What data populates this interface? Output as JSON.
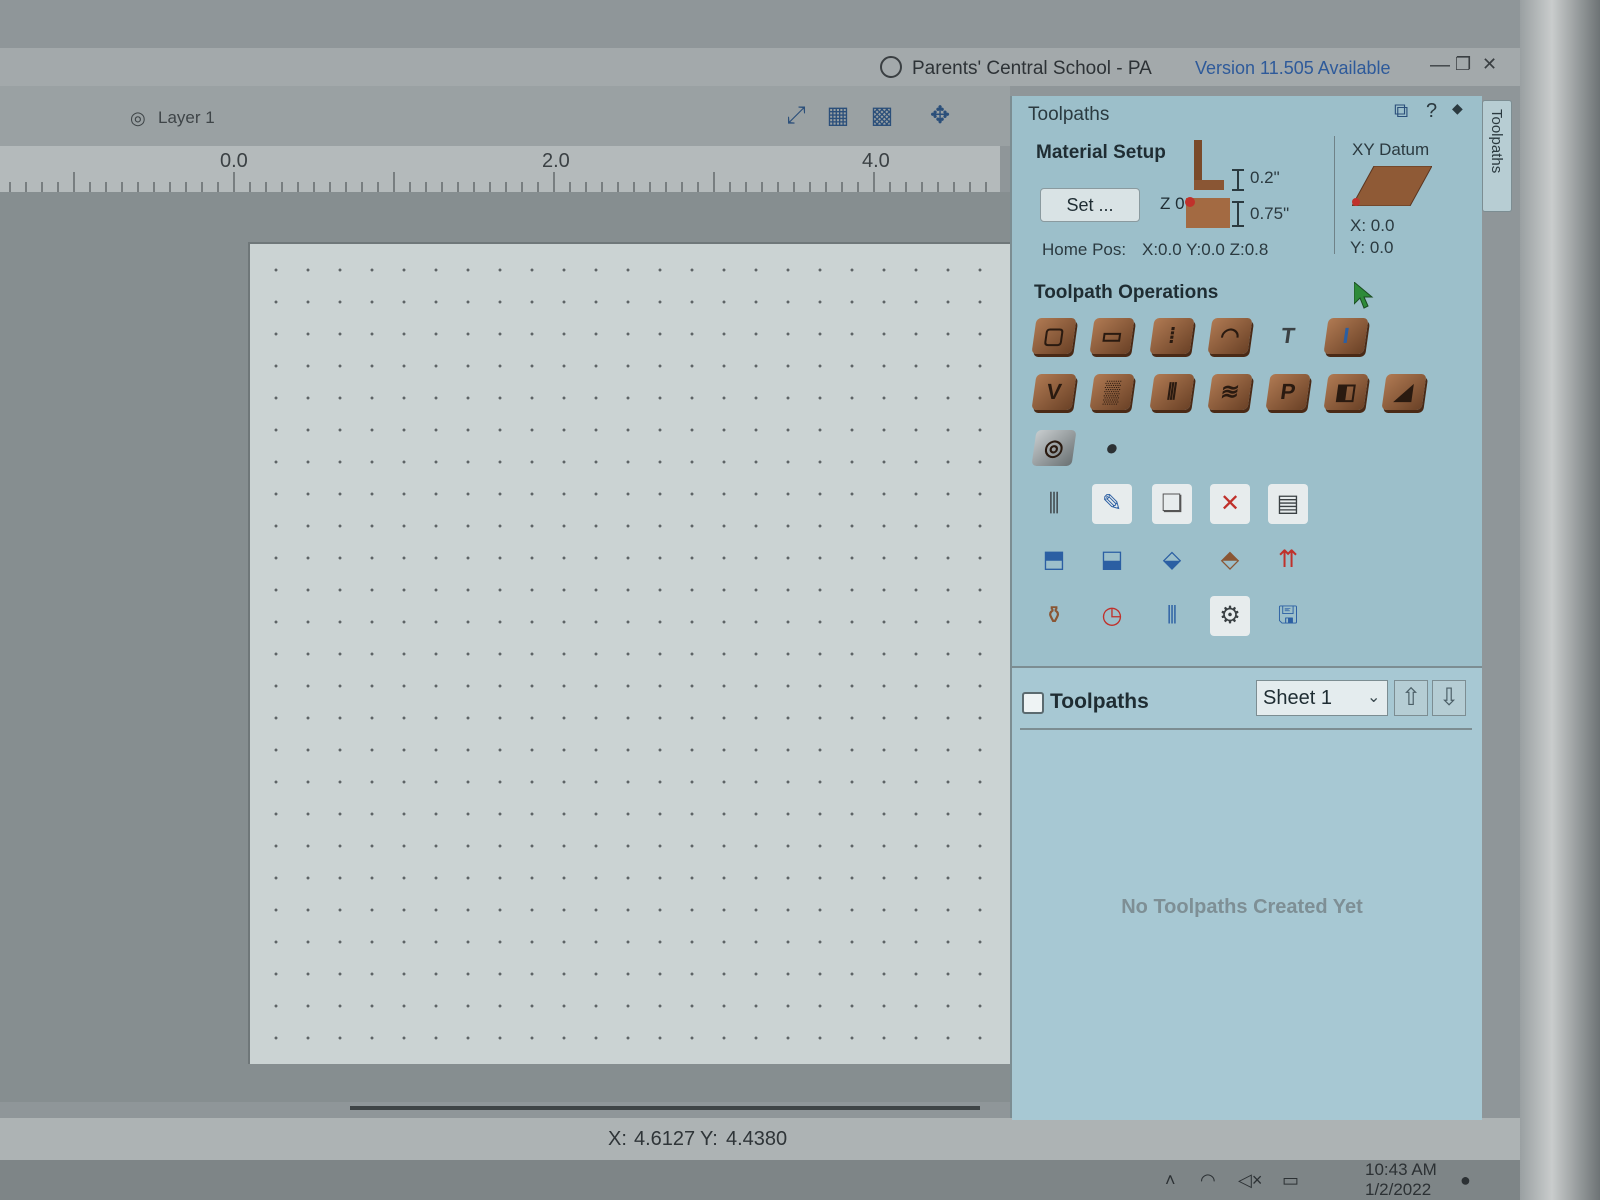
{
  "window": {
    "school_name": "Parents' Central School - PA",
    "version_link": "Version 11.505 Available",
    "min_glyph": "—",
    "max_glyph": "❐",
    "close_glyph": "✕"
  },
  "toolbar": {
    "layer_label": "Layer 1",
    "icons": [
      "resize-icon",
      "snap-grid-icon",
      "grid-icon",
      "move-icon"
    ]
  },
  "ruler": {
    "labels": [
      "0.0",
      "2.0",
      "4.0"
    ]
  },
  "status": {
    "x_label": "X:",
    "x_value": "4.6127",
    "y_label": "Y:",
    "y_value": "4.4380"
  },
  "taskbar": {
    "time": "10:43 AM",
    "date": "1/2/2022"
  },
  "panel": {
    "title": "Toolpaths",
    "side_tab": "Toolpaths",
    "help_glyph": "?",
    "material_setup": {
      "title": "Material Setup",
      "set_button": "Set ...",
      "z_label": "Z 0",
      "clearance": "0.2\"",
      "thickness": "0.75\"",
      "home_pos_label": "Home Pos:",
      "home_pos_value": "X:0.0 Y:0.0 Z:0.8"
    },
    "xy_datum": {
      "title": "XY Datum",
      "x": "X: 0.0",
      "y": "Y: 0.0"
    },
    "operations_title": "Toolpath Operations",
    "operations_row1": [
      "profile-toolpath-icon",
      "pocket-toolpath-icon",
      "drilling-toolpath-icon",
      "quick-engrave-icon",
      "texture-text-icon",
      "inlay-toolpath-icon"
    ],
    "operations_row2": [
      "vcarve-toolpath-icon",
      "3d-roughing-icon",
      "fluting-toolpath-icon",
      "texture-toolpath-icon",
      "prism-carving-icon",
      "moulding-toolpath-icon",
      "chamfer-toolpath-icon"
    ],
    "operations_row3": [
      "3d-finishing-icon",
      "3d-sphere-icon"
    ],
    "utilities_row1": [
      "tool-database-icon",
      "edit-gcode-icon",
      "merge-toolpaths-icon",
      "delete-toolpaths-icon",
      "toolpath-calculator-icon"
    ],
    "utilities_row2": [
      "save-toolpath-icon",
      "save-toolpath-alt-icon",
      "export-toolpath-icon",
      "template-toolpath-icon",
      "merge-output-icon"
    ],
    "utilities_row3": [
      "tool-preview-icon",
      "time-estimate-icon",
      "toolpath-order-icon",
      "job-settings-icon",
      "save-all-toolpaths-icon"
    ]
  },
  "toolpath_list": {
    "title": "Toolpaths",
    "sheet": "Sheet 1",
    "up_glyph": "⇧",
    "down_glyph": "⇩",
    "empty_message": "No Toolpaths Created Yet"
  }
}
